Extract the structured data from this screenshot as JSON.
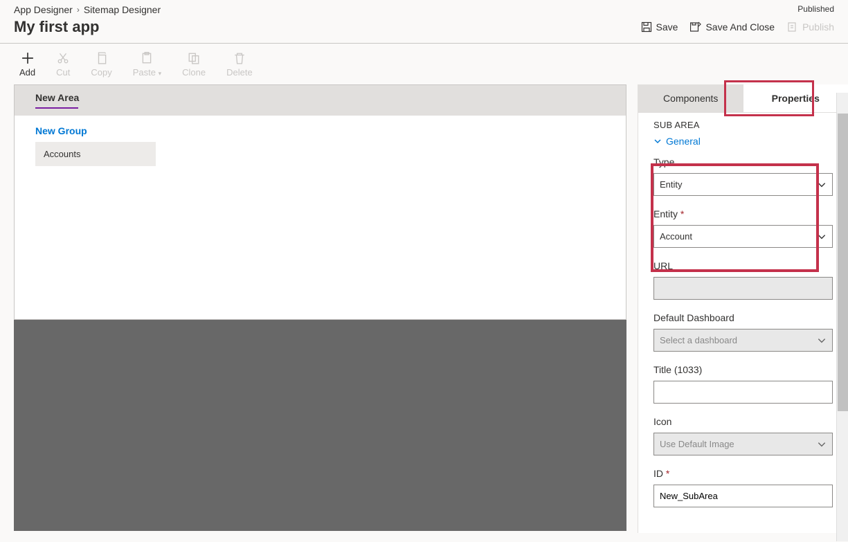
{
  "breadcrumb": {
    "root": "App Designer",
    "current": "Sitemap Designer"
  },
  "status": "Published",
  "app_title": "My first app",
  "commands": {
    "save": "Save",
    "save_close": "Save And Close",
    "publish": "Publish"
  },
  "toolbar": {
    "add": "Add",
    "cut": "Cut",
    "copy": "Copy",
    "paste": "Paste",
    "clone": "Clone",
    "delete": "Delete"
  },
  "sitemap": {
    "area": "New Area",
    "group": "New Group",
    "subarea": "Accounts"
  },
  "panel": {
    "tabs": {
      "components": "Components",
      "properties": "Properties"
    },
    "section": "SUB AREA",
    "general": "General",
    "fields": {
      "type_label": "Type",
      "type_value": "Entity",
      "entity_label": "Entity",
      "entity_value": "Account",
      "url_label": "URL",
      "url_value": "",
      "dash_label": "Default Dashboard",
      "dash_placeholder": "Select a dashboard",
      "title_label": "Title (1033)",
      "title_value": "",
      "icon_label": "Icon",
      "icon_value": "Use Default Image",
      "id_label": "ID",
      "id_value": "New_SubArea"
    }
  }
}
